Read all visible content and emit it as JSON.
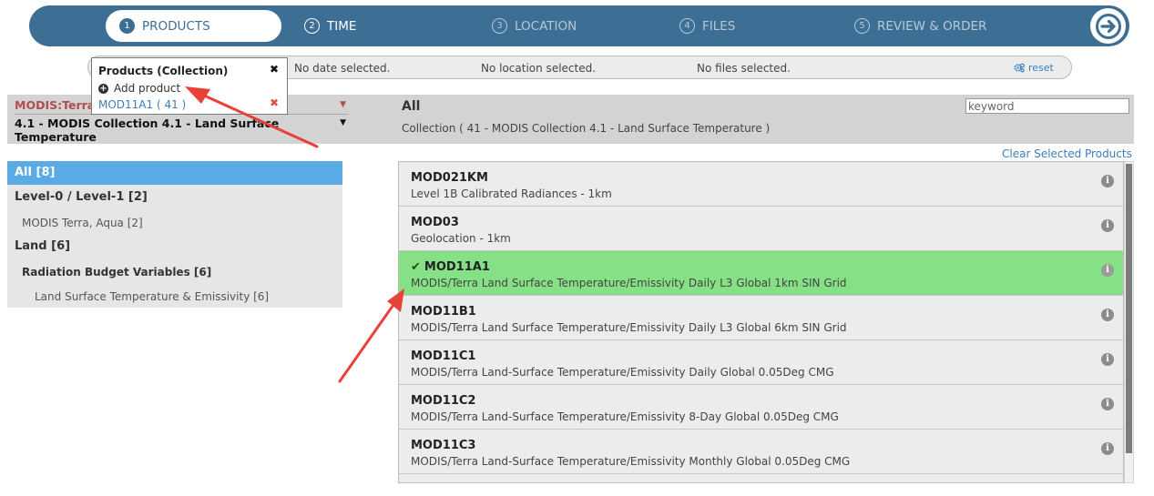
{
  "wizard": {
    "steps": [
      {
        "num": "1",
        "label": "PRODUCTS"
      },
      {
        "num": "2",
        "label": "TIME"
      },
      {
        "num": "3",
        "label": "LOCATION"
      },
      {
        "num": "4",
        "label": "FILES"
      },
      {
        "num": "5",
        "label": "REVIEW & ORDER"
      }
    ],
    "next_icon": "arrow-right-circle-icon"
  },
  "summary": {
    "date": "No date selected.",
    "location": "No location selected.",
    "files": "No files selected.",
    "reset_label": "reset",
    "reset_icon": "gears-icon"
  },
  "popup": {
    "title": "Products (Collection)",
    "close_glyph": "✖",
    "add_label": "Add product",
    "item_label": "MOD11A1 ( 41 )",
    "remove_glyph": "✖"
  },
  "filters": {
    "satellite_label": "MODIS:Terra",
    "collection_label": "4.1 - MODIS Collection 4.1 - Land Surface Temperature",
    "heading": "All",
    "collection_summary": "Collection ( 41 - MODIS Collection 4.1 - Land Surface Temperature )",
    "keyword_placeholder": "keyword"
  },
  "tree": {
    "all": "All [8]",
    "items": [
      "Level-0 / Level-1 [2]",
      "MODIS Terra, Aqua [2]",
      "Land [6]",
      "Radiation Budget Variables [6]",
      "Land Surface Temperature & Emissivity [6]"
    ]
  },
  "products": {
    "clear_label": "Clear Selected Products",
    "rows": [
      {
        "name": "MOD021KM",
        "desc": "Level 1B Calibrated Radiances - 1km",
        "selected": false
      },
      {
        "name": "MOD03",
        "desc": "Geolocation - 1km",
        "selected": false
      },
      {
        "name": "MOD11A1",
        "desc": "MODIS/Terra Land Surface Temperature/Emissivity Daily L3 Global 1km SIN Grid",
        "selected": true
      },
      {
        "name": "MOD11B1",
        "desc": "MODIS/Terra Land Surface Temperature/Emissivity Daily L3 Global 6km SIN Grid",
        "selected": false
      },
      {
        "name": "MOD11C1",
        "desc": "MODIS/Terra Land-Surface Temperature/Emissivity Daily Global 0.05Deg CMG",
        "selected": false
      },
      {
        "name": "MOD11C2",
        "desc": "MODIS/Terra Land-Surface Temperature/Emissivity 8-Day Global 0.05Deg CMG",
        "selected": false
      },
      {
        "name": "MOD11C3",
        "desc": "MODIS/Terra Land-Surface Temperature/Emissivity Monthly Global 0.05Deg CMG",
        "selected": false
      }
    ]
  },
  "colors": {
    "wizard_bg": "#3d6f94",
    "selected_row": "#86e086",
    "tree_active": "#5aaae6",
    "link": "#3d7dbd",
    "annotation_arrow": "#e8413a"
  }
}
